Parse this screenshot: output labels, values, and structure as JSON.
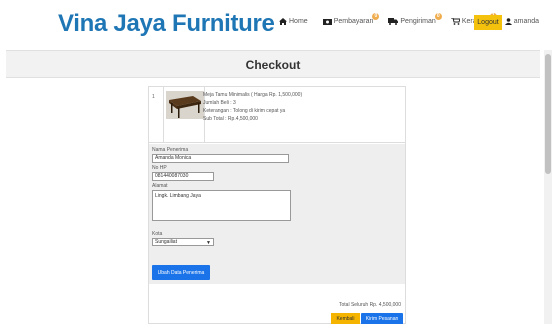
{
  "header": {
    "brand": "Vina Jaya Furniture",
    "nav": {
      "home": "Home",
      "pembayaran": "Pembayaran",
      "pembayaran_badge": "0",
      "pengiriman": "Pengiriman",
      "pengiriman_badge": "0",
      "keranjang": "Keranjang",
      "keranjang_badge": "1",
      "user": "amanda"
    },
    "logout_label": "Logout"
  },
  "checkout": {
    "title": "Checkout",
    "item": {
      "number": "1",
      "name": "Meja Tamu Minimalis",
      "price_line": "Meja Tamu Minimalis ( Harga Rp. 1,500,000)",
      "qty_line": "Jumlah Beli : 3",
      "note_line": "Keterangan : Tolong di kirim cepat ya",
      "subtotal_line": "Sub Total : Rp.4,500,000"
    },
    "form": {
      "name_label": "Nama Penerima",
      "name_value": "Amanda Monica",
      "phone_label": "No HP",
      "phone_value": "081440087030",
      "address_label": "Alamat",
      "address_value": "Lingk. Limbang Jaya",
      "city_label": "Kota",
      "city_value": "Sungailiat",
      "update_button": "Ubah Data Penerima"
    },
    "total_line": "Total Seluruh Rp. 4,500,000",
    "back_button": "Kembali",
    "send_button": "Kirim Pesanan"
  },
  "colors": {
    "brand": "#1f76b5",
    "accent_yellow": "#f4c20d",
    "button_blue": "#1a73e8"
  }
}
